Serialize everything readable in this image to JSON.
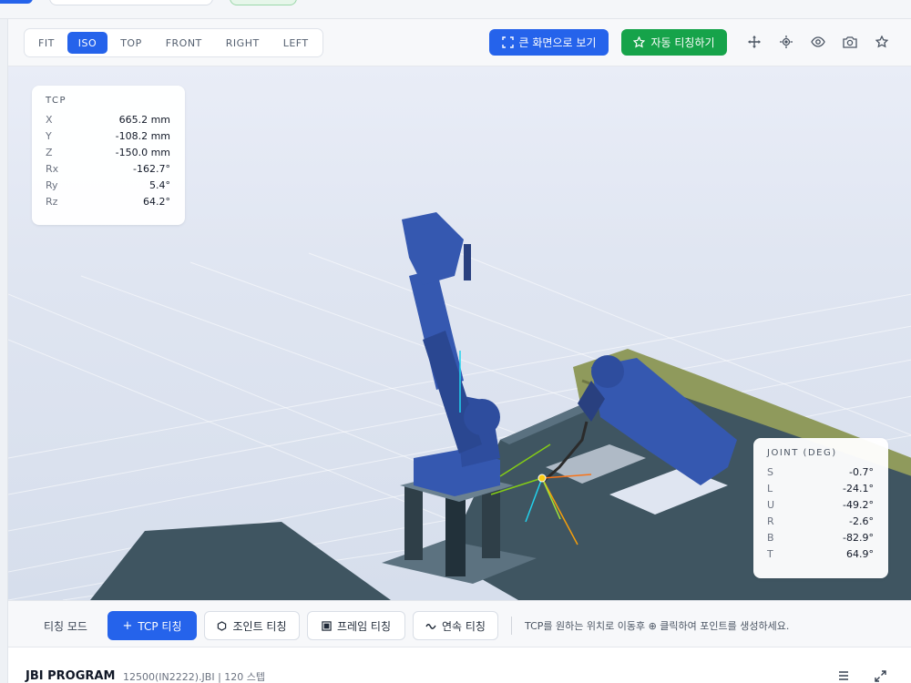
{
  "toolbar": {
    "view_buttons": [
      {
        "label": "FIT",
        "active": false
      },
      {
        "label": "ISO",
        "active": true
      },
      {
        "label": "TOP",
        "active": false
      },
      {
        "label": "FRONT",
        "active": false
      },
      {
        "label": "RIGHT",
        "active": false
      },
      {
        "label": "LEFT",
        "active": false
      }
    ],
    "fullscreen_label": "큰 화면으로 보기",
    "auto_teach_label": "자동 티칭하기",
    "icons": [
      "move-icon",
      "target-icon",
      "eye-icon",
      "camera-icon",
      "star-icon"
    ]
  },
  "tcp": {
    "title": "TCP",
    "rows": [
      {
        "key": "X",
        "value": "665.2 mm"
      },
      {
        "key": "Y",
        "value": "-108.2 mm"
      },
      {
        "key": "Z",
        "value": "-150.0 mm"
      },
      {
        "key": "Rx",
        "value": "-162.7°"
      },
      {
        "key": "Ry",
        "value": "5.4°"
      },
      {
        "key": "Rz",
        "value": "64.2°"
      }
    ]
  },
  "joint": {
    "title": "JOINT (DEG)",
    "rows": [
      {
        "key": "S",
        "value": "-0.7°"
      },
      {
        "key": "L",
        "value": "-24.1°"
      },
      {
        "key": "U",
        "value": "-49.2°"
      },
      {
        "key": "R",
        "value": "-2.6°"
      },
      {
        "key": "B",
        "value": "-82.9°"
      },
      {
        "key": "T",
        "value": "64.9°"
      }
    ]
  },
  "teaching": {
    "mode_label": "티칭 모드",
    "buttons": [
      {
        "label": "TCP 티칭",
        "icon": "plus-icon",
        "active": true
      },
      {
        "label": "조인트 티칭",
        "icon": "hexagon-icon",
        "active": false
      },
      {
        "label": "프레임 티칭",
        "icon": "frame-icon",
        "active": false
      },
      {
        "label": "연속 티칭",
        "icon": "wave-icon",
        "active": false
      }
    ],
    "hint": "TCP를 원하는 위치로 이동후 ⊕ 클릭하여 포인트를 생성하세요."
  },
  "program": {
    "title": "JBI PROGRAM",
    "subtitle": "12500(IN2222).JBI | 120 스텝"
  },
  "colors": {
    "primary": "#2563eb",
    "success": "#16a34a",
    "robot": "#3558b0",
    "fixture": "#8f9a5c",
    "table": "#3f5561"
  }
}
